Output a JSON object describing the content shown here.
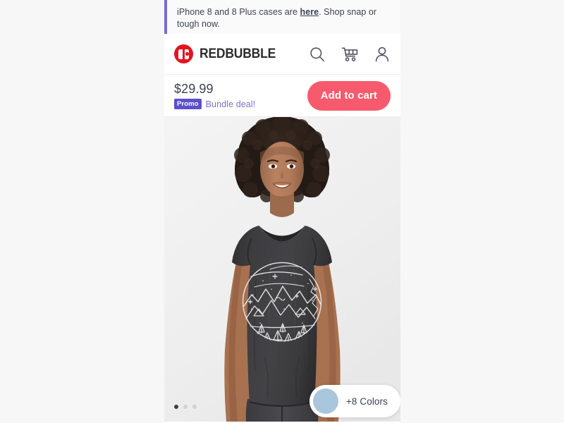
{
  "page": {
    "background_color": "#f7f7f7",
    "card_background": "#ffffff"
  },
  "banner": {
    "name": "promo-banner",
    "text_before_link": "iPhone 8 and 8 Plus cases are ",
    "link_text": "here",
    "text_after_link": ". Shop snap or tough now.",
    "accent_color": "#7b68d6",
    "background_color": "#fafafa"
  },
  "header": {
    "brand_name": "REDBUBBLE",
    "logo_color": "#e41321",
    "icons": [
      {
        "name": "search-icon",
        "label": "Search"
      },
      {
        "name": "cart-icon",
        "label": "Cart"
      },
      {
        "name": "account-icon",
        "label": "Account"
      }
    ]
  },
  "product": {
    "price": "$29.99",
    "promo_badge": "Promo",
    "promo_label": "Bundle deal!",
    "promo_badge_color": "#5c4fcf",
    "promo_label_color": "#7b72d6",
    "add_to_cart_label": "Add to cart",
    "add_to_cart_color": "#f75a6c"
  },
  "gallery": {
    "pagination": [
      {
        "active": true
      },
      {
        "active": false
      },
      {
        "active": false
      }
    ],
    "active_dot_color": "#3d3a52",
    "inactive_dot_color": "#d2d2d6",
    "color_picker_label": "+8 Colors",
    "color_swatch_hex": "#a9c6dd",
    "shirt_color": "#3a3a3c",
    "photo_background": "#efefef"
  }
}
